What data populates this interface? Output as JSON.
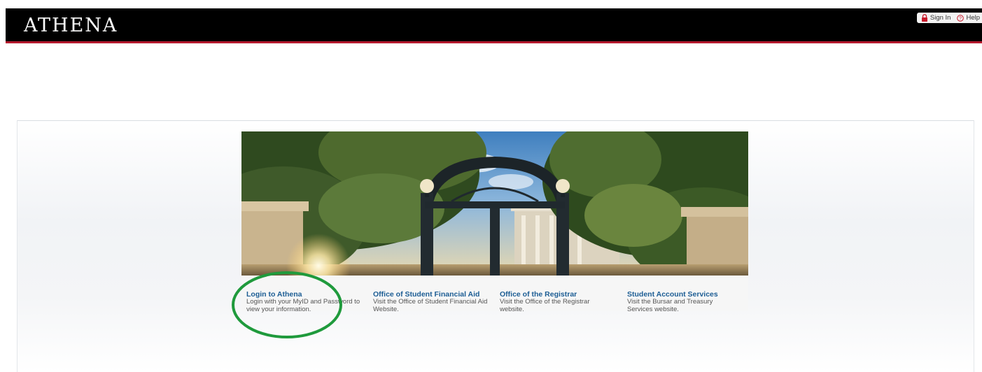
{
  "top_strip": {
    "partial_link": "",
    "partial_text": ""
  },
  "header": {
    "logo": "ATHENA",
    "sign_in_label": "Sign In",
    "help_label": "Help"
  },
  "links": [
    {
      "title": "Login to Athena",
      "description": "Login with your MyID and Password to view your information."
    },
    {
      "title": "Office of Student Financial Aid",
      "description": "Visit the Office of Student Financial Aid Website."
    },
    {
      "title": "Office of the Registrar",
      "description": "Visit the Office of the Registrar website."
    },
    {
      "title": "Student Account Services",
      "description": "Visit the Bursar and Treasury Services website."
    }
  ],
  "colors": {
    "header_bg": "#000000",
    "header_accent": "#b51a2e",
    "link_title": "#1c5d94",
    "highlight_ring": "#1f9a3c"
  },
  "icons": {
    "sign_in": "lock-icon",
    "help": "help-circle-icon",
    "hero": "campus-arch-photo"
  }
}
